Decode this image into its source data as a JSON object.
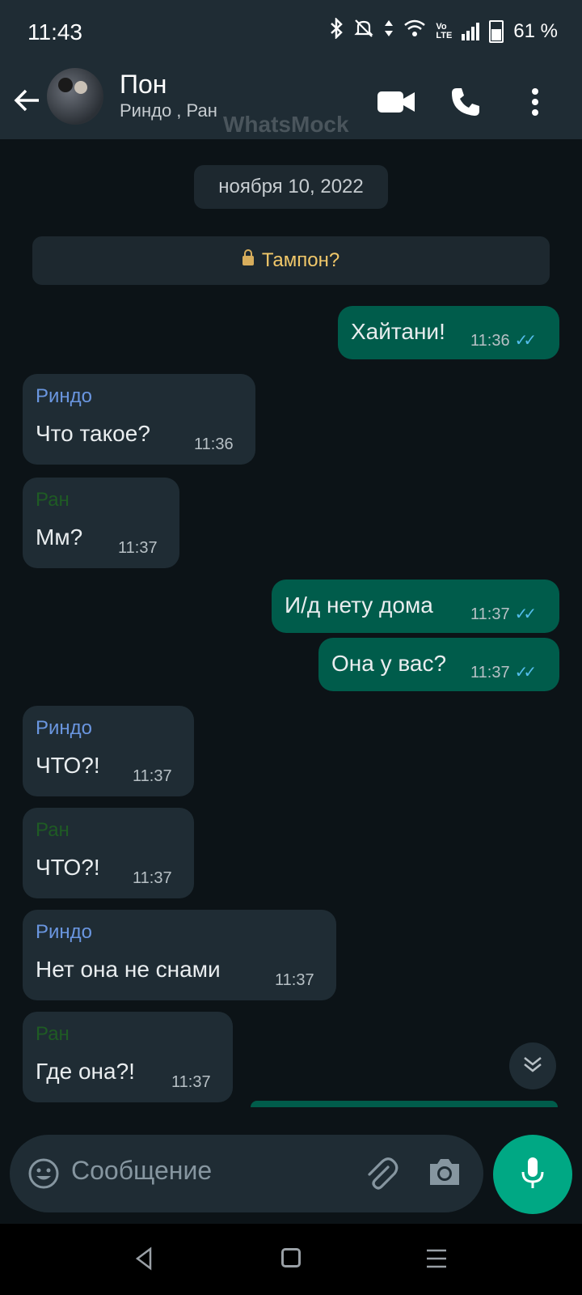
{
  "status_bar": {
    "time": "11:43",
    "battery": "61 %"
  },
  "header": {
    "title": "Пон",
    "subtitle": "Риндо , Ран",
    "watermark": "WhatsMock"
  },
  "date_chip": "ноября 10, 2022",
  "system_message": "Тампон?",
  "messages": [
    {
      "type": "out",
      "text": "Хайтани!",
      "time": "11:36",
      "ticks": "✓✓"
    },
    {
      "type": "in",
      "sender": "Риндо",
      "text": "Что такое?",
      "time": "11:36"
    },
    {
      "type": "in",
      "sender": "Ран",
      "text": "Мм?",
      "time": "11:37"
    },
    {
      "type": "out",
      "text": "И/д нету дома",
      "time": "11:37",
      "ticks": "✓✓"
    },
    {
      "type": "out",
      "text": "Она у вас?",
      "time": "11:37",
      "ticks": "✓✓"
    },
    {
      "type": "in",
      "sender": "Риндо",
      "text": "ЧТО?!",
      "time": "11:37"
    },
    {
      "type": "in",
      "sender": "Ран",
      "text": "ЧТО?!",
      "time": "11:37"
    },
    {
      "type": "in",
      "sender": "Риндо",
      "text": "Нет она не снами",
      "time": "11:37"
    },
    {
      "type": "in",
      "sender": "Ран",
      "text": "Где она?!",
      "time": "11:37"
    }
  ],
  "input": {
    "placeholder": "Сообщение"
  },
  "colors": {
    "header_bg": "#1f2c34",
    "chat_bg": "#0c1317",
    "outgoing": "#005c4b",
    "incoming": "#1f2c34",
    "accent": "#00a884",
    "read_ticks": "#53bdeb"
  }
}
